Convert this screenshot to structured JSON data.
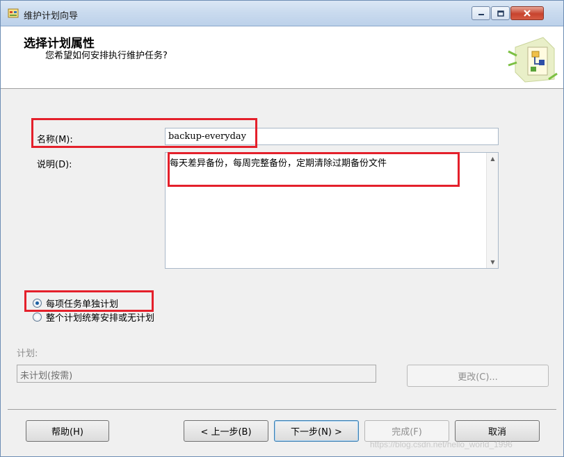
{
  "window": {
    "title": "维护计划向导",
    "controls": [
      "minimize",
      "maximize",
      "close"
    ]
  },
  "header": {
    "title": "选择计划属性",
    "subtitle": "您希望如何安排执行维护任务?"
  },
  "form": {
    "name_label": "名称(M):",
    "name_value": "backup-everyday",
    "description_label": "说明(D):",
    "description_value": "每天差异备份，每周完整备份，定期清除过期备份文件"
  },
  "schedule_options": {
    "option1": "每项任务单独计划",
    "option2": "整个计划统筹安排或无计划",
    "selected": 0
  },
  "plan": {
    "label": "计划:",
    "value": "未计划(按需)",
    "change_button": "更改(C)..."
  },
  "buttons": {
    "help": "帮助(H)",
    "prev": "< 上一步(B)",
    "next": "下一步(N) >",
    "finish": "完成(F)",
    "cancel": "取消"
  },
  "watermark": "https://blog.csdn.net/hello_world_1996",
  "colors": {
    "highlight": "#e4202b",
    "titlebar": "#c9daee",
    "radio_dot": "#1c5fa3"
  }
}
